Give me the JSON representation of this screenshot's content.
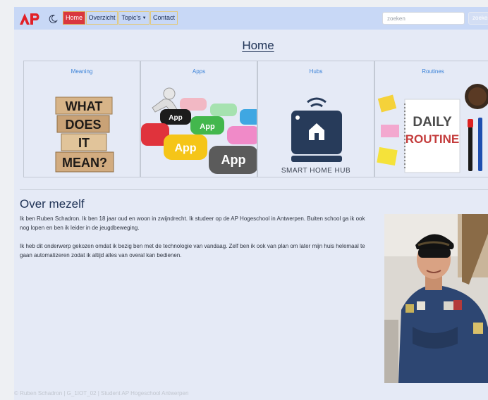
{
  "nav": {
    "items": [
      {
        "label": "Home",
        "active": true
      },
      {
        "label": "Overzicht"
      },
      {
        "label": "Topic's",
        "dropdown": true
      },
      {
        "label": "Contact"
      }
    ],
    "search_placeholder": "zoeken",
    "search_button": "zoeken",
    "logo_text": "AP"
  },
  "page_title": "Home",
  "cards": [
    {
      "title": "Meaning",
      "image_text": [
        "WHAT",
        "DOES",
        "IT",
        "MEAN?"
      ]
    },
    {
      "title": "Apps",
      "image_text": "App"
    },
    {
      "title": "Hubs",
      "caption": "SMART HOME HUB"
    },
    {
      "title": "Routines",
      "image_text": [
        "DAILY",
        "ROUTINE"
      ]
    }
  ],
  "about": {
    "title": "Over mezelf",
    "paragraphs": [
      "Ik ben Ruben Schadron. Ik ben 18 jaar oud en woon in zwijndrecht. Ik studeer op de AP Hogeschool in Antwerpen. Buiten school ga ik ook nog lopen en ben ik leider in de jeugdbeweging.",
      "Ik heb dit onderwerp gekozen omdat ik bezig ben met de technologie van vandaag. Zelf ben ik ook van plan om later mijn huis helemaal te gaan automatizeren zodat ik altijd alles van overal kan bedienen."
    ]
  },
  "footer": "© Ruben Schadron | G_1IOT_02 | Student AP Hogeschool Antwerpen",
  "colors": {
    "accent": "#d9363e",
    "navbar": "#c8d8f6",
    "background": "#e5eaf6",
    "link": "#3a82d8"
  },
  "icons": [
    "ap-logo-icon",
    "moon-icon",
    "caret-down-icon"
  ]
}
